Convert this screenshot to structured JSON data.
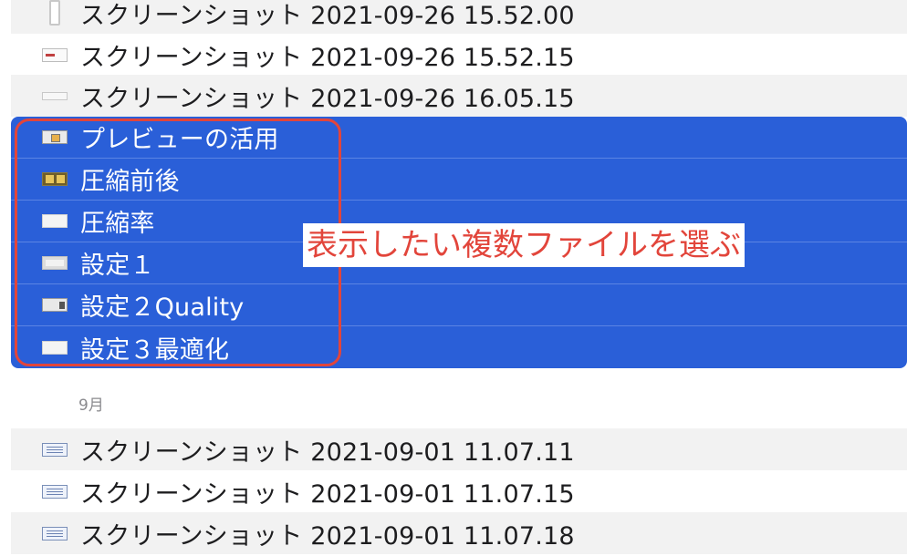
{
  "files_before": [
    {
      "name": "スクリーンショット 2021-09-26 15.52.00",
      "icon": "tall-document-thumbnail-icon"
    },
    {
      "name": "スクリーンショット 2021-09-26 15.52.15",
      "icon": "screenshot-thumbnail-icon"
    },
    {
      "name": "スクリーンショット 2021-09-26 16.05.15",
      "icon": "wide-screenshot-thumbnail-icon"
    }
  ],
  "selected_files": [
    {
      "name": "プレビューの活用",
      "icon": "preview-thumbnail-icon"
    },
    {
      "name": "圧縮前後",
      "icon": "comparison-thumbnail-icon"
    },
    {
      "name": "圧縮率",
      "icon": "image-thumbnail-icon"
    },
    {
      "name": "設定１",
      "icon": "settings-thumbnail-icon"
    },
    {
      "name": "設定２Quality",
      "icon": "settings-dialog-thumbnail-icon"
    },
    {
      "name": "設定３最適化",
      "icon": "image-thumbnail-icon"
    }
  ],
  "section": {
    "label": "9月"
  },
  "files_after": [
    {
      "name": "スクリーンショット 2021-09-01 11.07.11",
      "icon": "document-thumbnail-icon"
    },
    {
      "name": "スクリーンショット 2021-09-01 11.07.15",
      "icon": "document-thumbnail-icon"
    },
    {
      "name": "スクリーンショット 2021-09-01 11.07.18",
      "icon": "document-thumbnail-icon"
    }
  ],
  "annotation": {
    "text": "表示したい複数ファイルを選ぶ"
  },
  "colors": {
    "selection": "#2a5fd8",
    "annotation": "#e2453b",
    "stripe": "#f2f2f2"
  }
}
